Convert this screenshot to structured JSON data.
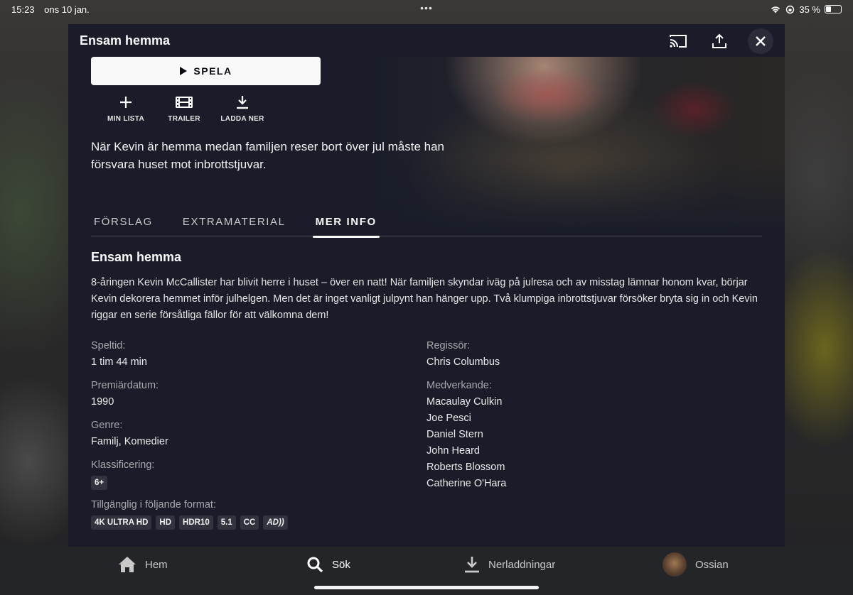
{
  "status_bar": {
    "time": "15:23",
    "date": "ons 10 jan.",
    "dots": "•••",
    "battery": "35 %"
  },
  "modal": {
    "title": "Ensam hemma",
    "play_label": "SPELA",
    "actions": [
      {
        "label": "MIN LISTA",
        "icon": "plus-icon"
      },
      {
        "label": "TRAILER",
        "icon": "film-icon"
      },
      {
        "label": "LADDA NER",
        "icon": "download-icon"
      }
    ],
    "synopsis": "När Kevin är hemma medan familjen reser bort över jul måste han försvara huset mot inbrottstjuvar."
  },
  "tabs": [
    {
      "label": "FÖRSLAG",
      "active": false
    },
    {
      "label": "EXTRAMATERIAL",
      "active": false
    },
    {
      "label": "MER INFO",
      "active": true
    }
  ],
  "info": {
    "title": "Ensam hemma",
    "description": "8-åringen Kevin McCallister har blivit herre i huset – över en natt! När familjen skyndar iväg på julresa och av misstag lämnar honom kvar, börjar Kevin dekorera hemmet inför julhelgen. Men det är inget vanligt julpynt han hänger upp. Två klumpiga inbrottstjuvar försöker bryta sig in och Kevin riggar en serie försåtliga fällor för att välkomna dem!",
    "runtime_label": "Speltid:",
    "runtime": "1 tim 44 min",
    "release_label": "Premiärdatum:",
    "release": "1990",
    "genre_label": "Genre:",
    "genre": "Familj, Komedier",
    "rating_label": "Klassificering:",
    "rating": "6+",
    "formats_label": "Tillgänglig i följande format:",
    "formats": [
      "4K ULTRA HD",
      "HD",
      "HDR10",
      "5.1",
      "CC",
      "AD"
    ],
    "director_label": "Regissör:",
    "director": "Chris Columbus",
    "cast_label": "Medverkande:",
    "cast": [
      "Macaulay Culkin",
      "Joe Pesci",
      "Daniel Stern",
      "John Heard",
      "Roberts Blossom",
      "Catherine O'Hara"
    ]
  },
  "nav": [
    {
      "label": "Hem",
      "icon": "home-icon"
    },
    {
      "label": "Sök",
      "icon": "search-icon",
      "active": true
    },
    {
      "label": "Nerladdningar",
      "icon": "download-icon"
    },
    {
      "label": "Ossian",
      "icon": "avatar"
    }
  ],
  "colors": {
    "background": "#1a1d29",
    "text": "#f9f9f9",
    "muted": "#a6a7ab",
    "badge": "#31343e"
  }
}
